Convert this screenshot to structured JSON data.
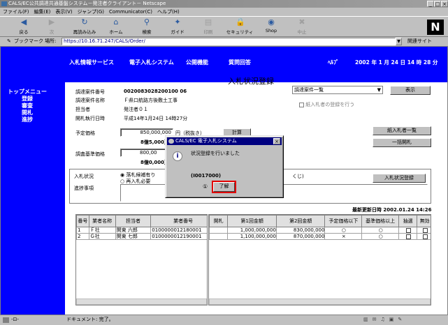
{
  "window": {
    "title": "CALS/EC公共調達共通基盤システム－発注者クライアント－ Netscape",
    "min": "_",
    "max": "□",
    "close": "×"
  },
  "menu": [
    "ファイル(F)",
    "編集(E)",
    "表示(V)",
    "ジャンプ(G)",
    "Communicator(C)",
    "ヘルプ(H)"
  ],
  "toolbar": [
    {
      "label": "戻る",
      "icon": "back-icon",
      "glyph": "◀"
    },
    {
      "label": "次",
      "icon": "forward-icon",
      "glyph": "▶"
    },
    {
      "label": "再読み込み",
      "icon": "reload-icon",
      "glyph": "↻"
    },
    {
      "label": "ホーム",
      "icon": "home-icon",
      "glyph": "⌂"
    },
    {
      "label": "検索",
      "icon": "search-icon",
      "glyph": "⚲"
    },
    {
      "label": "ガイド",
      "icon": "guide-icon",
      "glyph": "✦"
    },
    {
      "label": "印刷",
      "icon": "print-icon",
      "glyph": "▤"
    },
    {
      "label": "セキュリティ",
      "icon": "security-icon",
      "glyph": "🔒"
    },
    {
      "label": "Shop",
      "icon": "shop-icon",
      "glyph": "◉"
    },
    {
      "label": "中止",
      "icon": "stop-icon",
      "glyph": "✖"
    }
  ],
  "location": {
    "bookmarks": "ブックマーク",
    "label": "場所:",
    "url": "https://10.16.71.247/CALS/Order/",
    "related": "関連サイト"
  },
  "nav": [
    "入札情報サービス",
    "電子入札システム",
    "公開機能",
    "質問回答",
    "ﾍﾙﾌﾟ",
    "2002 年 1 月 24 日 14 時 28 分"
  ],
  "side_menu": [
    "トップメニュー",
    "登録",
    "審査",
    "開札",
    "進捗"
  ],
  "page": {
    "title": "入札状況登録",
    "case_select": "調達案件一覧",
    "display_button": "表示",
    "paper_bidder_label": "紙入札者の登録を行う",
    "fields": [
      {
        "label": "調達案件番号",
        "value": "0020083028200100 06"
      },
      {
        "label": "調達案件名称",
        "value": "Ｆ県口航路方後敷土工事"
      },
      {
        "label": "担当者",
        "value": "発注者０１"
      },
      {
        "label": "開札執行日時",
        "value": "平成14年1月24日 14時27分"
      }
    ],
    "planned_price_label": "予定価格",
    "planned_price_value": "850,000,000",
    "planned_price_unit": "円（税抜き）",
    "planned_price_kanji": "8億5,000万",
    "calc_button": "計算",
    "base_price_label": "調査基準価格",
    "base_price_value": "800,00",
    "base_price_kanji": "8億0,000万",
    "paper_list_button": "紙入札者一覧",
    "bulk_open_button": "一括開札",
    "status_label": "入札状況",
    "status_opt1": "落札候補有り",
    "status_opt2": "再入札必要",
    "status_tail": "くじ)",
    "progress_label": "進捗事項",
    "status_register_button": "入札状況登録",
    "last_update": "最新更新日時 2002.01.24 14:26"
  },
  "left_table": {
    "headers": [
      "番号",
      "業者名称",
      "担当者",
      "業者番号"
    ],
    "rows": [
      [
        "1",
        "Ｆ社",
        "関東 六郎",
        "0100000012180001"
      ],
      [
        "2",
        "Ｇ社",
        "関東 七郎",
        "0100000012190001"
      ]
    ]
  },
  "right_table": {
    "headers": [
      "開札",
      "第1回金額",
      "第2回金額",
      "予定価格以下",
      "基準価格以上",
      "抽選",
      "無効"
    ],
    "rows": [
      [
        "",
        "1,000,000,000",
        "830,000,000",
        "○",
        "○",
        "",
        ""
      ],
      [
        "",
        "1,100,000,000",
        "870,000,000",
        "×",
        "○",
        "",
        ""
      ]
    ]
  },
  "dialog": {
    "title": "CALS/EC 電子入札システム",
    "message": "状況登録を行いました",
    "code": "(I0017000)",
    "ok": "了解",
    "ok_prefix": "①",
    "close": "×"
  },
  "status": {
    "text": "ドキュメント: 完了。"
  }
}
